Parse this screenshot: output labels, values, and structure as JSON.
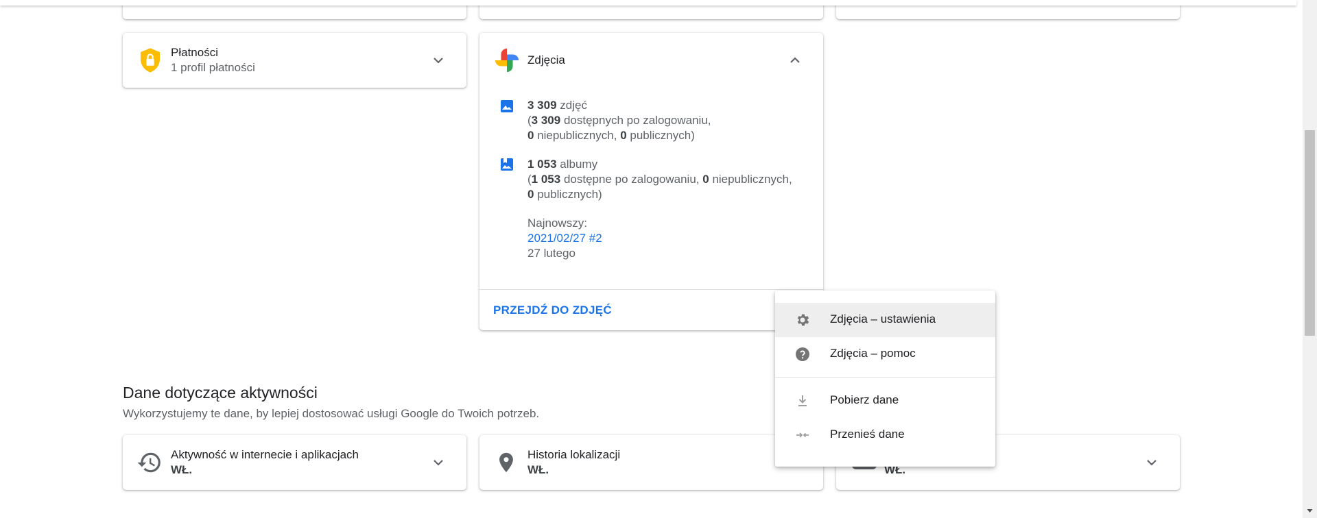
{
  "payments": {
    "title": "Płatności",
    "subtitle": "1 profil płatności"
  },
  "photos": {
    "title": "Zdjęcia",
    "photos_count": "3 309",
    "photos_word": "zdjęć",
    "photos_available_count": "3 309",
    "photos_available_text": "dostępnych po zalogowaniu,",
    "photos_private_count": "0",
    "photos_private_text": "niepublicznych,",
    "photos_public_count": "0",
    "photos_public_text": "publicznych)",
    "albums_count": "1 053",
    "albums_word": "albumy",
    "albums_available_count": "1 053",
    "albums_available_text": "dostępne po zalogowaniu,",
    "albums_private_count": "0",
    "albums_private_text": "niepublicznych,",
    "albums_public_count": "0",
    "albums_public_text": "publicznych)",
    "newest_label": "Najnowszy:",
    "newest_album": "2021/02/27 #2",
    "newest_date": "27 lutego",
    "go_to_photos": "PRZEJDŹ DO ZDJĘĆ"
  },
  "menu": {
    "items": [
      {
        "label": "Zdjęcia – ustawienia",
        "icon": "gear-icon"
      },
      {
        "label": "Zdjęcia – pomoc",
        "icon": "help-icon"
      },
      {
        "label": "Pobierz dane",
        "icon": "download-icon"
      },
      {
        "label": "Przenieś dane",
        "icon": "transfer-icon"
      }
    ]
  },
  "activity": {
    "title": "Dane dotyczące aktywności",
    "description": "Wykorzystujemy te dane, by lepiej dostosować usługi Google do Twoich potrzeb.",
    "cards": [
      {
        "title": "Aktywność w internecie i aplikacjach",
        "status": "WŁ.",
        "icon": "history-icon"
      },
      {
        "title": "Historia lokalizacji",
        "status": "WŁ.",
        "icon": "location-pin-icon"
      },
      {
        "title": "",
        "status": "WŁ.",
        "icon": "youtube-icon"
      }
    ]
  },
  "colors": {
    "accent": "#1a73e8",
    "shield": "#fbbc04",
    "hover": "#eeeeee"
  }
}
